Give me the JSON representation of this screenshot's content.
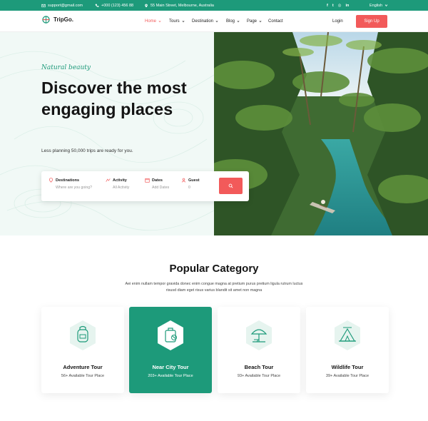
{
  "topbar": {
    "email": "support@gmail.com",
    "phone": "+000 (123) 456 88",
    "address": "55 Main Street, Melbourne, Australia",
    "social": [
      "f",
      "t",
      "ig",
      "in"
    ],
    "language": "English"
  },
  "nav": {
    "logo": "TripGo.",
    "items": [
      {
        "label": "Home"
      },
      {
        "label": "Tours"
      },
      {
        "label": "Destination"
      },
      {
        "label": "Blog"
      },
      {
        "label": "Page"
      },
      {
        "label": "Contact"
      }
    ],
    "login": "Login",
    "signup": "Sign Up"
  },
  "hero": {
    "tagline": "Natural beauty",
    "headline": "Discover the most engaging places",
    "subtitle": "Less planning 50,000 trips are ready for you."
  },
  "search": {
    "fields": [
      {
        "label": "Destinations",
        "placeholder": "Where are you going?",
        "icon": "location-pin-icon"
      },
      {
        "label": "Activity",
        "placeholder": "All Activity",
        "icon": "activity-icon"
      },
      {
        "label": "Dates",
        "placeholder": "Add Dates",
        "icon": "calendar-icon"
      },
      {
        "label": "Guest",
        "placeholder": "0",
        "icon": "user-icon"
      }
    ]
  },
  "popular": {
    "title": "Popular Category",
    "description": "Aei enim nullam tempor gravida donec enim  congue magna at pretium purus pretium ligula rutrum luctus risusd diam eget risus varius blandit sit amet non magna",
    "cards": [
      {
        "title": "Adventure Tour",
        "subtitle": "56+ Available Tour Place",
        "icon": "backpack-icon"
      },
      {
        "title": "Near City Tour",
        "subtitle": "203+ Available Tour Place",
        "icon": "luggage-icon"
      },
      {
        "title": "Beach Tour",
        "subtitle": "93+ Available Tour Place",
        "icon": "beach-umbrella-icon"
      },
      {
        "title": "Wildlife Tour",
        "subtitle": "39+ Available Tour Place",
        "icon": "tent-icon"
      }
    ]
  },
  "colors": {
    "primary": "#1d9a7a",
    "accent": "#f25a5a",
    "hero_bg": "#f1f9f6"
  }
}
